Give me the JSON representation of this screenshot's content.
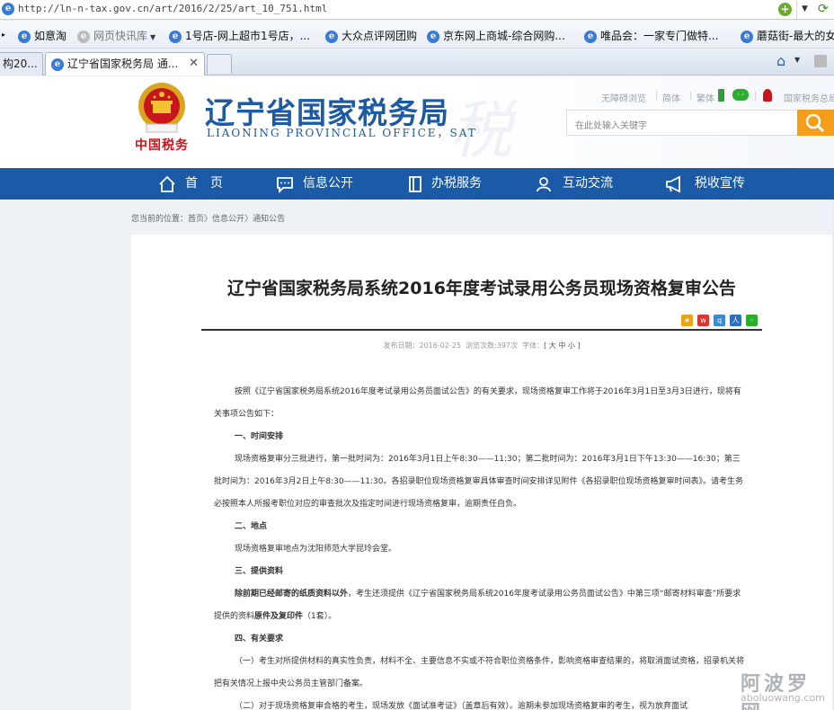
{
  "browser": {
    "url": "http://ln-n-tax.gov.cn/art/2016/2/25/art_10_751.html",
    "favorites": [
      {
        "label": "如意淘",
        "muted": false
      },
      {
        "label": "网页快讯库",
        "muted": true
      },
      {
        "label": "1号店-网上超市1号店，...",
        "muted": false
      },
      {
        "label": "大众点评网团购",
        "muted": false
      },
      {
        "label": "京东网上商城-综合网购...",
        "muted": false
      },
      {
        "label": "唯品会：一家专门做特...",
        "muted": false
      },
      {
        "label": "蘑菇街-最大的女",
        "muted": false
      }
    ],
    "tabs": [
      {
        "title": "构20...",
        "active": false
      },
      {
        "title": "辽宁省国家税务局 通...",
        "active": true
      }
    ]
  },
  "header": {
    "seal_text": "中国税务",
    "title": "辽宁省国家税务局",
    "subtitle_en": "LIAONING PROVINCIAL OFFICE，SAT",
    "watermark": "税",
    "tools": [
      "无障碍浏览",
      "简体",
      "繁体",
      "国家税务总局"
    ],
    "search_placeholder": "在此处输入关键字"
  },
  "nav": [
    {
      "label": "首　页",
      "icon": "home-icon"
    },
    {
      "label": "信息公开",
      "icon": "message-icon"
    },
    {
      "label": "办税服务",
      "icon": "book-icon"
    },
    {
      "label": "互动交流",
      "icon": "user-icon"
    },
    {
      "label": "税收宣传",
      "icon": "megaphone-icon"
    }
  ],
  "breadcrumb": {
    "prefix": "您当前的位置：",
    "items": [
      "首页",
      "信息公开",
      "通知公告"
    ],
    "sep": "〉"
  },
  "article": {
    "title": "辽宁省国家税务局系统2016年度考试录用公务员现场资格复审公告",
    "meta_date": "发布日期：2016-02-25",
    "meta_views": "浏览次数:397次",
    "meta_font_label": "字体：",
    "meta_font_sizes": "[ 大  中  小 ]",
    "p1": "按照《辽宁省国家税务局系统2016年度考试录用公务员面试公告》的有关要求，现场资格复审工作将于2016年3月1日至3月3日进行，现将有关事项公告如下：",
    "h1": "一、时间安排",
    "p2": "现场资格复审分三批进行，第一批时间为：2016年3月1日上午8:30——11:30；第二批时间为：2016年3月1日下午13:30——16:30；第三批时间为：2016年3月2日上午8:30——11:30。各招录职位现场资格复审具体审查时间安排详见附件《各招录职位现场资格复审时间表》。请考生务必按照本人所报考职位对应的审查批次及指定时间进行现场资格复审，逾期责任自负。",
    "h2": "二、地点",
    "p3": "现场资格复审地点为沈阳师范大学昆玲会堂。",
    "h3": "三、提供资料",
    "p4_bold": "除前期已经邮寄的纸质资料以外",
    "p4_a": "，考生还须提供《辽宁省国家税务局系统2016年度考试录用公务员面试公告》中第三项“邮寄材料审查”所要求提供的资料",
    "p4_bold2": "原件及复印件",
    "p4_b": "（1套）。",
    "h4": "四、有关要求",
    "p5": "（一）考生对所提供材料的真实性负责，材料不全、主要信息不实或不符合职位资格条件，影响资格审查结果的，将取消面试资格，招录机关将把有关情况上报中央公务员主管部门备案。",
    "p6": "（二）对于现场资格复审合格的考生，现场发放《面试准考证》（盖章后有效）。逾期未参加现场资格复审的考生，视为放弃面试"
  },
  "watermark_site": {
    "cn": "阿波罗网",
    "en": "aboluowang.com"
  }
}
